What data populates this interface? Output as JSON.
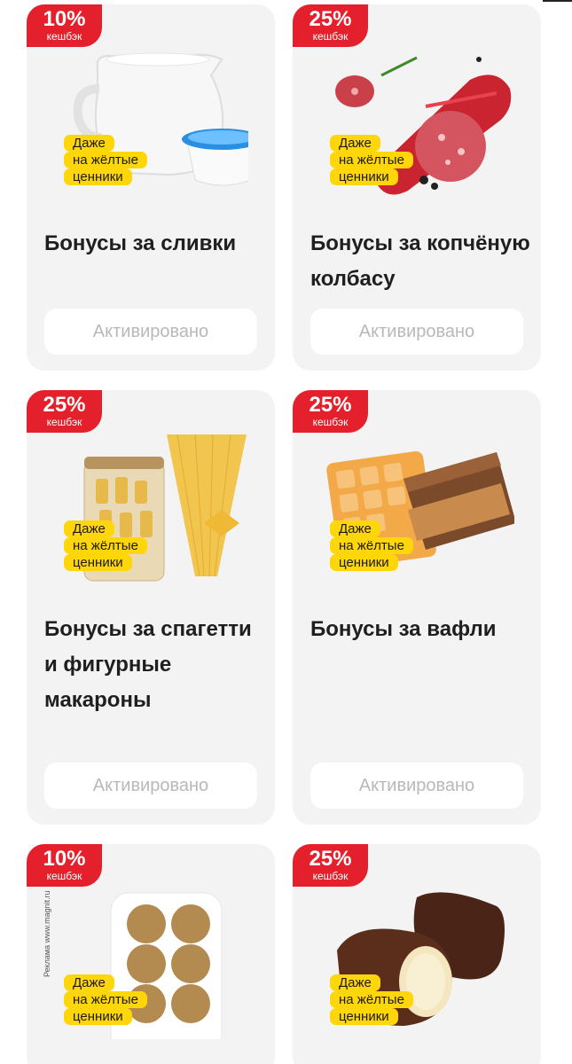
{
  "cards": [
    {
      "cashback_percent": "10%",
      "cashback_label": "кешбэк",
      "yellow_tag": [
        "Даже",
        "на жёлтые",
        "ценники"
      ],
      "title": "Бонусы за сливки",
      "button": "Активировано",
      "image": "cream-jug-and-portion-cup"
    },
    {
      "cashback_percent": "25%",
      "cashback_label": "кешбэк",
      "yellow_tag": [
        "Даже",
        "на жёлтые",
        "ценники"
      ],
      "title": "Бонусы за копчёную колбасу",
      "button": "Активировано",
      "image": "smoked-sausage-slices"
    },
    {
      "cashback_percent": "25%",
      "cashback_label": "кешбэк",
      "yellow_tag": [
        "Даже",
        "на жёлтые",
        "ценники"
      ],
      "title": "Бонусы за спагетти и фигурные макароны",
      "button": "Активировано",
      "image": "pasta-jar-and-spaghetti"
    },
    {
      "cashback_percent": "25%",
      "cashback_label": "кешбэк",
      "yellow_tag": [
        "Даже",
        "на жёлтые",
        "ценники"
      ],
      "title": "Бонусы за вафли",
      "button": "Активировано",
      "image": "waffles-and-chocolate-bar"
    },
    {
      "cashback_percent": "10%",
      "cashback_label": "кешбэк",
      "yellow_tag": [
        "Даже",
        "на жёлтые",
        "ценники"
      ],
      "title": "",
      "button": "",
      "image": "crispbread-rounds-on-tray",
      "ad_note": "Реклама www.magnit.ru"
    },
    {
      "cashback_percent": "25%",
      "cashback_label": "кешбэк",
      "yellow_tag": [
        "Даже",
        "на жёлтые",
        "ценники"
      ],
      "title": "",
      "button": "",
      "image": "chocolate-glazed-curd-bars"
    }
  ],
  "colors": {
    "badge_red": "#e4202c",
    "tag_yellow": "#ffd60a",
    "card_bg": "#f3f3f3",
    "button_text": "#b8b8b8"
  }
}
